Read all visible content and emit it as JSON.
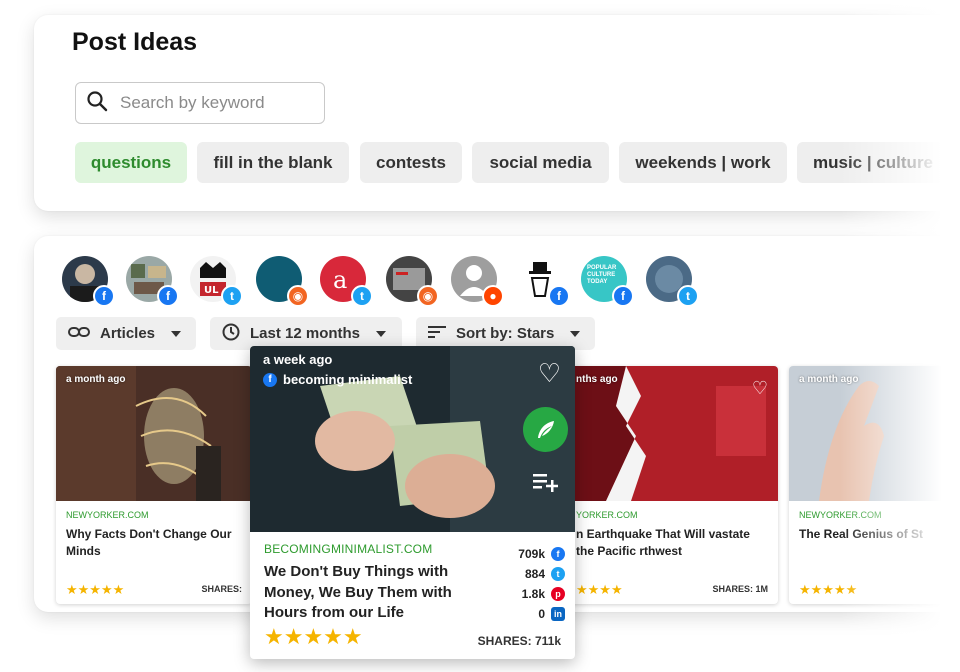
{
  "page": {
    "title": "Post Ideas"
  },
  "search": {
    "placeholder": "Search by keyword"
  },
  "chips": [
    {
      "label": "questions",
      "active": true
    },
    {
      "label": "fill in the blank"
    },
    {
      "label": "contests"
    },
    {
      "label": "social media"
    },
    {
      "label": "weekends | work"
    },
    {
      "label": "music | culture"
    }
  ],
  "sources": [
    {
      "name": "source-1",
      "network": "facebook",
      "badge_icon": "facebook-icon"
    },
    {
      "name": "source-2",
      "network": "facebook",
      "badge_icon": "facebook-icon"
    },
    {
      "name": "source-3",
      "network": "twitter",
      "badge_icon": "twitter-icon"
    },
    {
      "name": "source-4",
      "network": "rss",
      "badge_icon": "rss-icon"
    },
    {
      "name": "source-5",
      "network": "twitter",
      "badge_icon": "twitter-icon"
    },
    {
      "name": "source-6",
      "network": "rss",
      "badge_icon": "rss-icon"
    },
    {
      "name": "source-7",
      "network": "reddit",
      "badge_icon": "reddit-icon"
    },
    {
      "name": "source-8",
      "network": "facebook",
      "badge_icon": "facebook-icon"
    },
    {
      "name": "source-9",
      "network": "facebook",
      "badge_icon": "facebook-icon",
      "text": "POPULAR CULTURE TODAY"
    },
    {
      "name": "source-10",
      "network": "twitter",
      "badge_icon": "twitter-icon"
    }
  ],
  "filters": {
    "type": "Articles",
    "time": "Last 12 months",
    "sort": "Sort by: Stars"
  },
  "cards": [
    {
      "ago": "a month ago",
      "source": "NEWYORKER.COM",
      "headline": "Why Facts Don't Change Our Minds",
      "stars": "★★★★★",
      "shares": "SHARES:"
    },
    {
      "ago": "nths ago",
      "source": "YORKER.COM",
      "headline": "n Earthquake That Will vastate the Pacific rthwest",
      "stars": "★★★★",
      "shares": "SHARES: 1M"
    },
    {
      "ago": "a month ago",
      "source": "NEWYORKER.COM",
      "headline": "The Real Genius of St",
      "stars": "★★★★★",
      "shares": ""
    }
  ],
  "featured": {
    "ago": "a week ago",
    "author": "becoming minimalist",
    "source": "BECOMINGMINIMALIST.COM",
    "headline": "We Don't Buy Things with Money, We Buy Them with Hours from our Life",
    "stars": "★★★★★",
    "shares": "SHARES: 711k",
    "stats": [
      {
        "value": "709k",
        "network": "facebook"
      },
      {
        "value": "884",
        "network": "twitter"
      },
      {
        "value": "1.8k",
        "network": "pinterest"
      },
      {
        "value": "0",
        "network": "linkedin"
      }
    ]
  },
  "colors": {
    "accent_green": "#2e8b2e",
    "chip_active_bg": "#dff5dd",
    "star": "#f5b400",
    "facebook": "#1877f2",
    "twitter": "#1da1f2",
    "rss": "#f26522",
    "reddit": "#ff4500"
  }
}
